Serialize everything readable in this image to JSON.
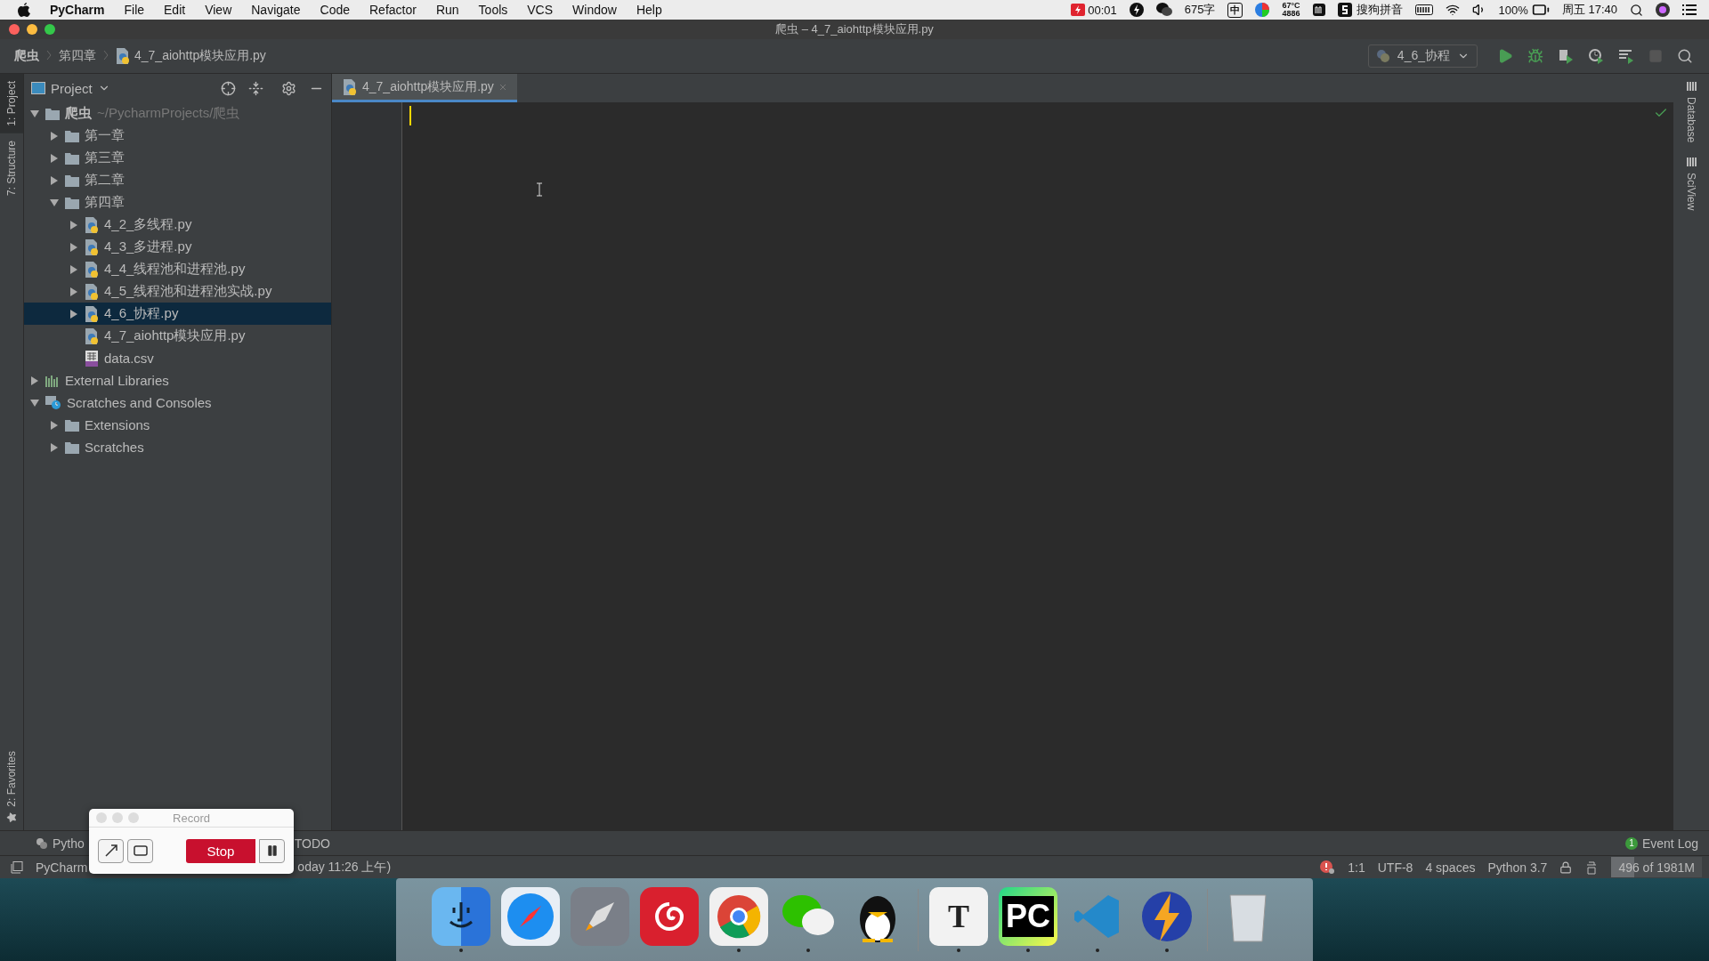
{
  "menubar": {
    "app": "PyCharm",
    "menus": [
      "File",
      "Edit",
      "View",
      "Navigate",
      "Code",
      "Refactor",
      "Run",
      "Tools",
      "VCS",
      "Window",
      "Help"
    ],
    "status": {
      "record_time": "00:01",
      "word_count": "675字",
      "input_mode": "中",
      "temperature": "67°C",
      "fan_speed": "4886",
      "ime": "搜狗拼音",
      "battery": "100%",
      "clock": "周五 17:40"
    }
  },
  "window": {
    "title": "爬虫 – 4_7_aiohttp模块应用.py"
  },
  "breadcrumb": [
    {
      "label": "爬虫",
      "kind": "project"
    },
    {
      "label": "第四章",
      "kind": "folder"
    },
    {
      "label": "4_7_aiohttp模块应用.py",
      "kind": "python"
    }
  ],
  "run_config": {
    "label": "4_6_协程"
  },
  "left_strip": [
    {
      "label": "1: Project",
      "selected": true
    },
    {
      "label": "7: Structure",
      "selected": false
    }
  ],
  "left_strip_bottom": {
    "label": "2: Favorites"
  },
  "project_panel": {
    "title": "Project",
    "tree": [
      {
        "label": "爬虫",
        "hint": "~/PycharmProjects/爬虫",
        "kind": "folder",
        "expanded": true,
        "selected": false,
        "children": [
          {
            "label": "第一章",
            "kind": "folder",
            "expanded": false,
            "selected": false
          },
          {
            "label": "第三章",
            "kind": "folder",
            "expanded": false,
            "selected": false
          },
          {
            "label": "第二章",
            "kind": "folder",
            "expanded": false,
            "selected": false
          },
          {
            "label": "第四章",
            "kind": "folder",
            "expanded": true,
            "selected": false,
            "children": [
              {
                "label": "4_2_多线程.py",
                "kind": "python",
                "expanded": false,
                "selected": false
              },
              {
                "label": "4_3_多进程.py",
                "kind": "python",
                "expanded": false,
                "selected": false
              },
              {
                "label": "4_4_线程池和进程池.py",
                "kind": "python",
                "expanded": false,
                "selected": false
              },
              {
                "label": "4_5_线程池和进程池实战.py",
                "kind": "python",
                "expanded": false,
                "selected": false
              },
              {
                "label": "4_6_协程.py",
                "kind": "python",
                "expanded": false,
                "selected": true
              },
              {
                "label": "4_7_aiohttp模块应用.py",
                "kind": "python",
                "selected": false
              },
              {
                "label": "data.csv",
                "kind": "csv",
                "selected": false
              }
            ]
          }
        ]
      },
      {
        "label": "External Libraries",
        "kind": "libraries",
        "expanded": false,
        "selected": false
      },
      {
        "label": "Scratches and Consoles",
        "kind": "scratches",
        "expanded": true,
        "selected": false,
        "children": [
          {
            "label": "Extensions",
            "kind": "folder",
            "expanded": false,
            "selected": false
          },
          {
            "label": "Scratches",
            "kind": "folder",
            "expanded": false,
            "selected": false
          }
        ]
      }
    ]
  },
  "editor": {
    "tabs": [
      {
        "label": "4_7_aiohttp模块应用.py",
        "selected": true
      }
    ]
  },
  "right_strip": [
    {
      "label": "Database"
    },
    {
      "label": "SciView"
    }
  ],
  "bottom_tabs": [
    {
      "label": "Pytho"
    },
    {
      "label": "TODO"
    }
  ],
  "event_log": {
    "count": "1",
    "label": "Event Log"
  },
  "status_bar": {
    "message_start": "PyCharm",
    "message_end": "oday 11:26 上午)",
    "position": "1:1",
    "encoding": "UTF-8",
    "indent": "4 spaces",
    "interpreter": "Python 3.7",
    "memory": {
      "text": "496 of 1981M",
      "level": 0.25
    }
  },
  "record_window": {
    "title": "Record",
    "stop": "Stop"
  },
  "dock": [
    {
      "kind": "smiley",
      "running": true
    },
    {
      "kind": "compass",
      "running": false
    },
    {
      "kind": "rocket",
      "running": false
    },
    {
      "kind": "swirl",
      "running": false
    },
    {
      "kind": "ring",
      "running": true
    },
    {
      "kind": "chat",
      "running": true
    },
    {
      "kind": "penguin",
      "running": false
    },
    {
      "kind": "separator"
    },
    {
      "kind": "letter",
      "label": "T",
      "running": true
    },
    {
      "kind": "letter-green",
      "label": "PC",
      "running": true
    },
    {
      "kind": "ribbon",
      "running": true
    },
    {
      "kind": "lightning",
      "running": true
    },
    {
      "kind": "separator"
    },
    {
      "kind": "trash",
      "running": false
    }
  ]
}
